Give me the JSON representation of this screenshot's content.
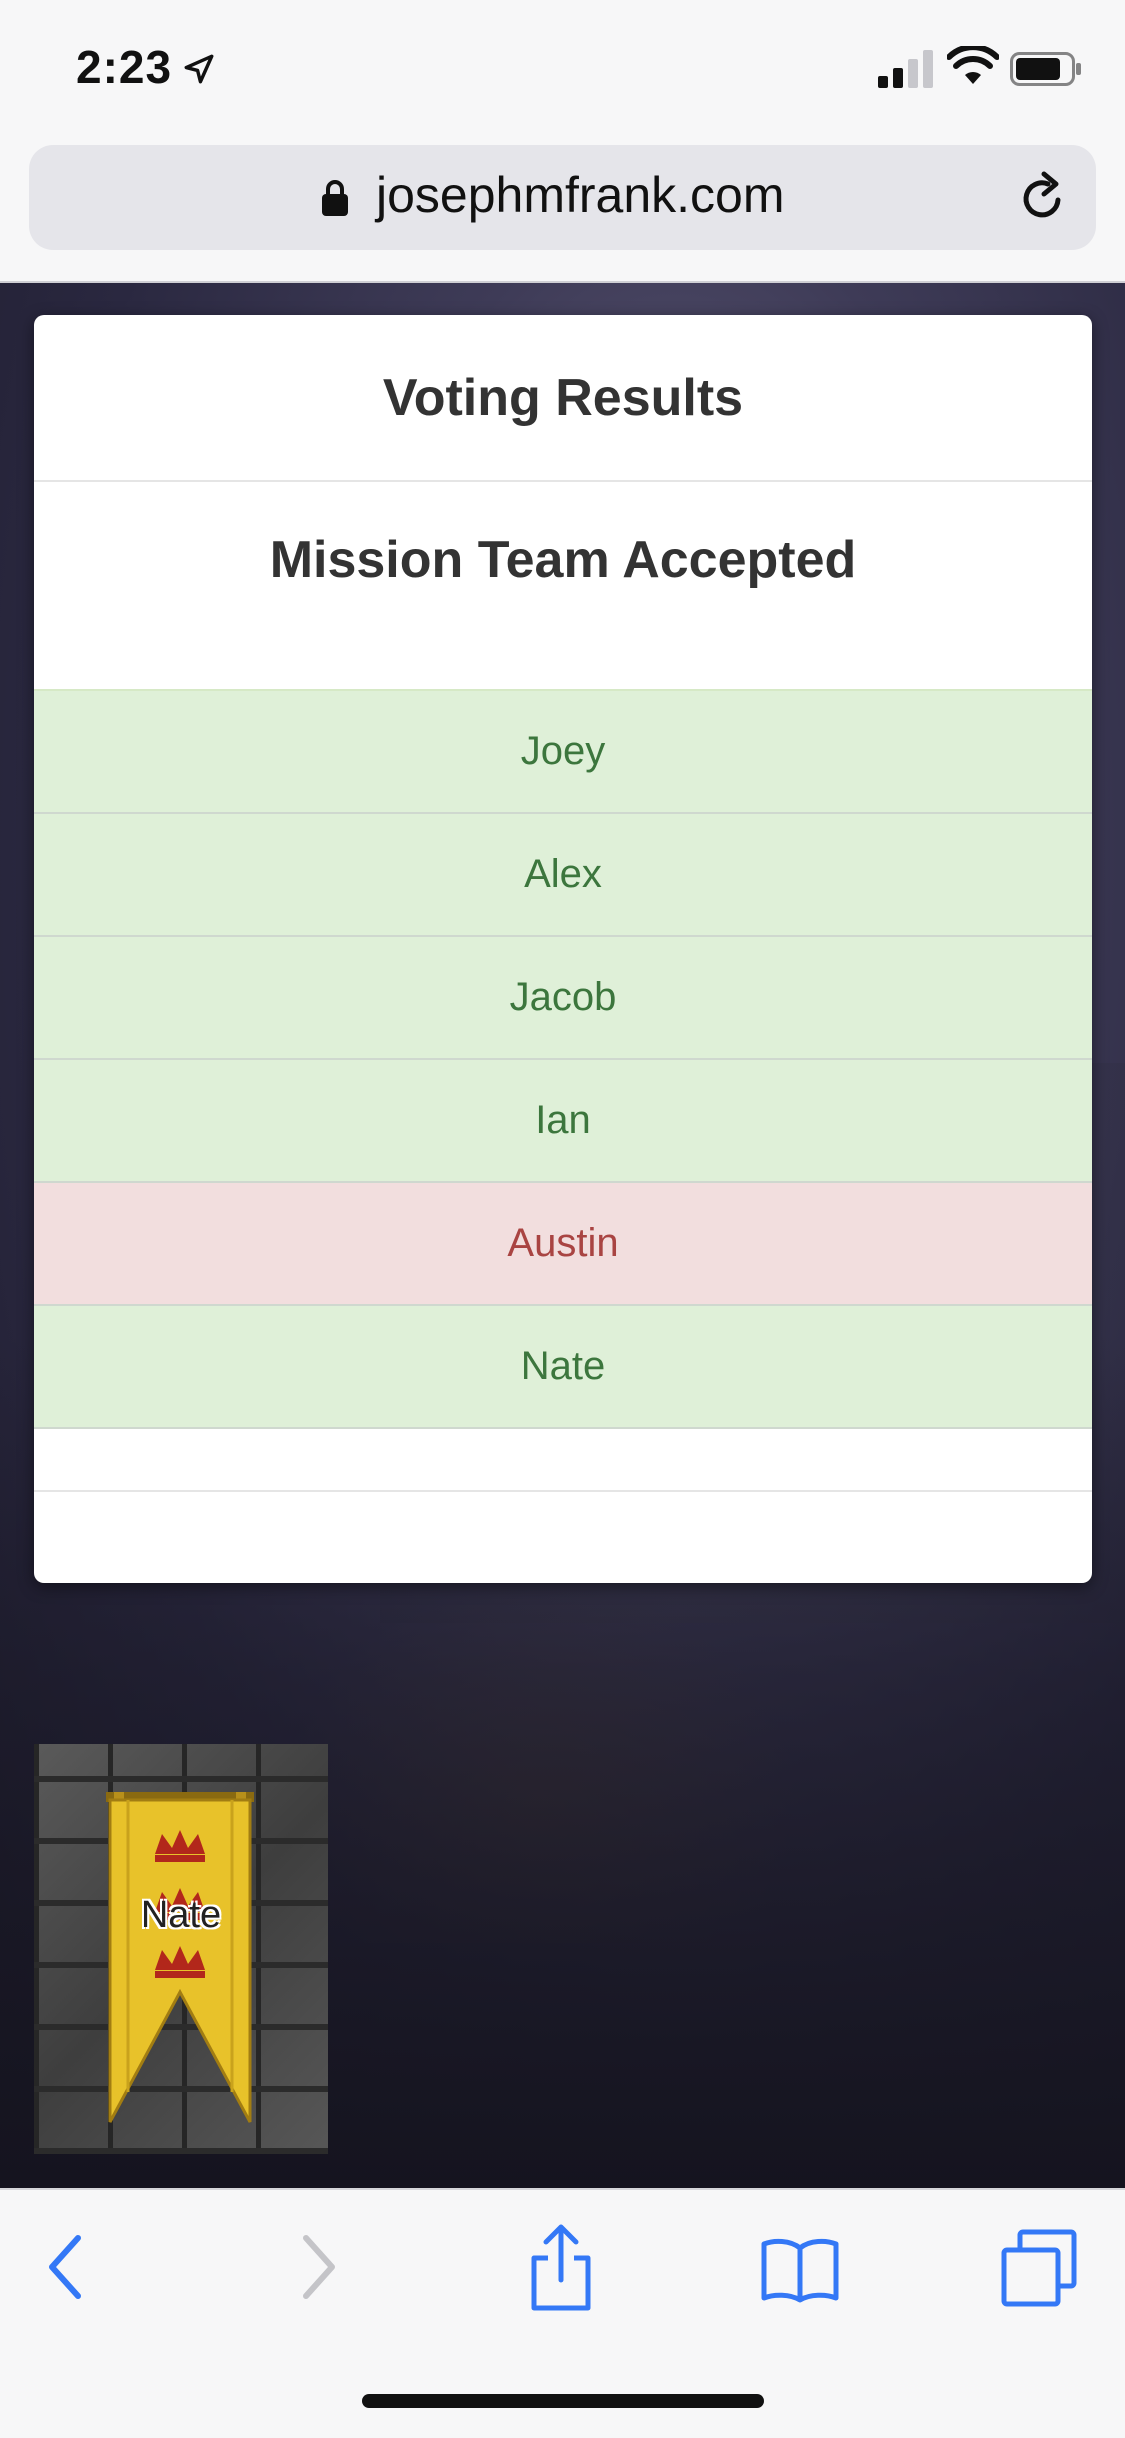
{
  "status_bar": {
    "time": "2:23"
  },
  "browser": {
    "url": "josephmfrank.com"
  },
  "modal": {
    "title": "Voting Results",
    "outcome": "Mission Team Accepted",
    "votes": [
      {
        "name": "Joey",
        "status": "approve"
      },
      {
        "name": "Alex",
        "status": "approve"
      },
      {
        "name": "Jacob",
        "status": "approve"
      },
      {
        "name": "Ian",
        "status": "approve"
      },
      {
        "name": "Austin",
        "status": "reject"
      },
      {
        "name": "Nate",
        "status": "approve"
      }
    ]
  },
  "player_card": {
    "name": "Nate"
  },
  "toolbar": {
    "icons": [
      "back-icon",
      "forward-icon",
      "share-icon",
      "bookmarks-icon",
      "tabs-icon"
    ]
  },
  "colors": {
    "approve_bg": "#dff0d8",
    "approve_text": "#3c763d",
    "reject_bg": "#f2dede",
    "reject_text": "#a94442",
    "ios_blue": "#3478f6"
  }
}
